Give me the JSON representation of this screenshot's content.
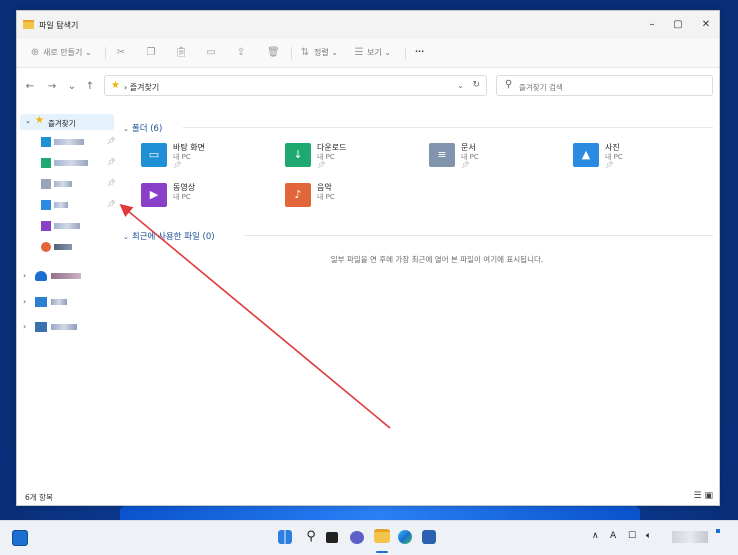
{
  "window": {
    "title": "파일 탐색기",
    "controls": {
      "minimize": "–",
      "maximize": "▢",
      "close": "✕"
    }
  },
  "toolbar": {
    "new_label": "새로 만들기",
    "sort_label": "정렬",
    "view_label": "보기",
    "more_label": "···"
  },
  "address": {
    "breadcrumb": "즐겨찾기",
    "search_placeholder": "즐겨찾기 검색"
  },
  "sidebar": {
    "favorites_label": "즐겨찾기"
  },
  "sections": {
    "folders_header": "폴더 (6)",
    "recent_header": "최근에 사용한 파일 (0)",
    "recent_empty": "일부 파일을 연 후에 가장 최근에 열어 본 파일이 여기에 표시됩니다."
  },
  "folders": [
    {
      "name": "바탕 화면",
      "sub": "내 PC",
      "color": "#1f8fd6"
    },
    {
      "name": "다운로드",
      "sub": "내 PC",
      "color": "#1fa870"
    },
    {
      "name": "문서",
      "sub": "내 PC",
      "color": "#8194ad"
    },
    {
      "name": "사진",
      "sub": "내 PC",
      "color": "#2a8be0"
    },
    {
      "name": "동영상",
      "sub": "내 PC",
      "color": "#8a3fc8"
    },
    {
      "name": "음악",
      "sub": "내 PC",
      "color": "#e2663a"
    }
  ],
  "status": {
    "item_count": "6개 항목"
  },
  "colors": {
    "accent": "#1a4e96",
    "annotation_arrow": "#e03a3a"
  }
}
